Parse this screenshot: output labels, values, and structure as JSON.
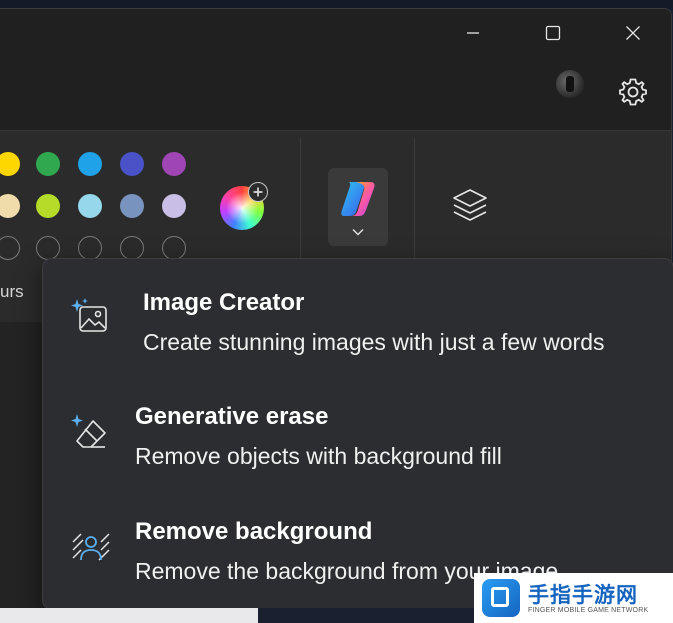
{
  "window": {
    "controls": {
      "minimize_icon": "minimize-icon",
      "maximize_icon": "maximize-icon",
      "close_icon": "close-icon"
    },
    "settings_icon": "gear-icon"
  },
  "ribbon": {
    "colours_label": "urs",
    "swatches_row1": [
      "#ffd700",
      "#2fa84f",
      "#1fa2e8",
      "#4a52c8",
      "#a046b4"
    ],
    "swatches_row2": [
      "#f0dcaa",
      "#b4dc28",
      "#96d7eb",
      "#7894be",
      "#c8bee6"
    ],
    "copilot_icon": "copilot-icon",
    "layers_icon": "layers-icon"
  },
  "menu": {
    "items": [
      {
        "title": "Image Creator",
        "description": "Create stunning images with just a few words",
        "icon": "image-sparkle-icon"
      },
      {
        "title": "Generative erase",
        "description": "Remove objects with background fill",
        "icon": "eraser-sparkle-icon"
      },
      {
        "title": "Remove background",
        "description": "Remove the background from your image",
        "icon": "remove-background-icon"
      }
    ]
  },
  "watermark": {
    "main": "手指手游网",
    "sub": "FINGER MOBILE GAME NETWORK"
  },
  "colors": {
    "accent": "#5ab0f0",
    "menu_bg": "#2c2d31",
    "window_bg": "#202020"
  }
}
